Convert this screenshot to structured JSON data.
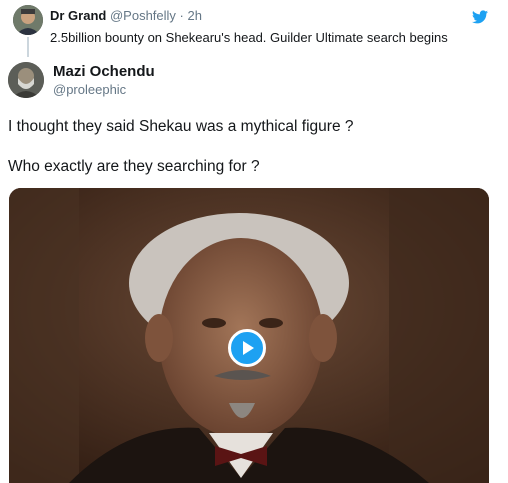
{
  "parent_tweet": {
    "author_name": "Dr Grand",
    "handle": "@Poshfelly",
    "separator": "·",
    "time": "2h",
    "text": "2.5billion bounty on Shekearu's head. Guilder Ultimate search begins"
  },
  "reply_tweet": {
    "author_name": "Mazi Ochendu",
    "handle": "@proleephic",
    "line1": "I thought they said Shekau was a mythical figure ?",
    "line2": "Who exactly are they searching for ?"
  },
  "icons": {
    "platform": "twitter-bird-icon",
    "media_control": "play-icon"
  },
  "colors": {
    "accent": "#1da1f2",
    "secondary_text": "#657786",
    "primary_text": "#14171a",
    "thread_line": "#ccd6dd"
  }
}
